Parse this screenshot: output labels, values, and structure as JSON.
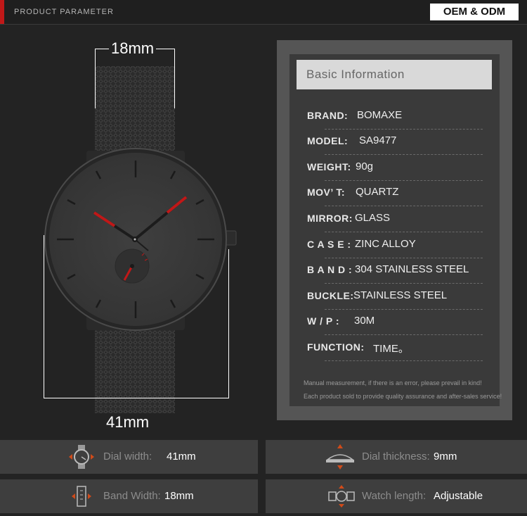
{
  "header": {
    "title": "PRODUCT PARAMETER",
    "badge": "OEM & ODM"
  },
  "watch": {
    "band_dimension": "18mm",
    "dial_dimension": "41mm"
  },
  "info_panel": {
    "heading": "Basic Information",
    "rows": [
      {
        "key": "BRAND:",
        "value": "BOMAXE"
      },
      {
        "key": "MODEL:",
        "value": "SA9477"
      },
      {
        "key": "WEIGHT:",
        "value": "90g"
      },
      {
        "key": "MOV’ T:",
        "value": "QUARTZ"
      },
      {
        "key": "MIRROR:",
        "value": "GLASS"
      },
      {
        "key": "C A S E :",
        "value": "ZINC ALLOY"
      },
      {
        "key": "B A N D :",
        "value": "304 STAINLESS STEEL"
      },
      {
        "key": "BUCKLE:",
        "value": "STAINLESS STEEL"
      },
      {
        "key": "W / P :",
        "value": "30M"
      },
      {
        "key": "FUNCTION:",
        "value": "TIME。"
      }
    ],
    "notes": [
      "Manual measurement, if there is an error, please prevail in kind!",
      "Each product sold to provide quality assurance and after-sales service!"
    ]
  },
  "specs": [
    {
      "icon": "dial-width-icon",
      "label": "Dial width:",
      "value": "41mm"
    },
    {
      "icon": "dial-thickness-icon",
      "label": "Dial thickness:",
      "value": "9mm"
    },
    {
      "icon": "band-width-icon",
      "label": "Band Width:",
      "value": "18mm"
    },
    {
      "icon": "watch-length-icon",
      "label": "Watch length:",
      "value": "Adjustable"
    }
  ],
  "colors": {
    "accent": "#c01818",
    "background": "#232323",
    "panel": "#555555"
  }
}
